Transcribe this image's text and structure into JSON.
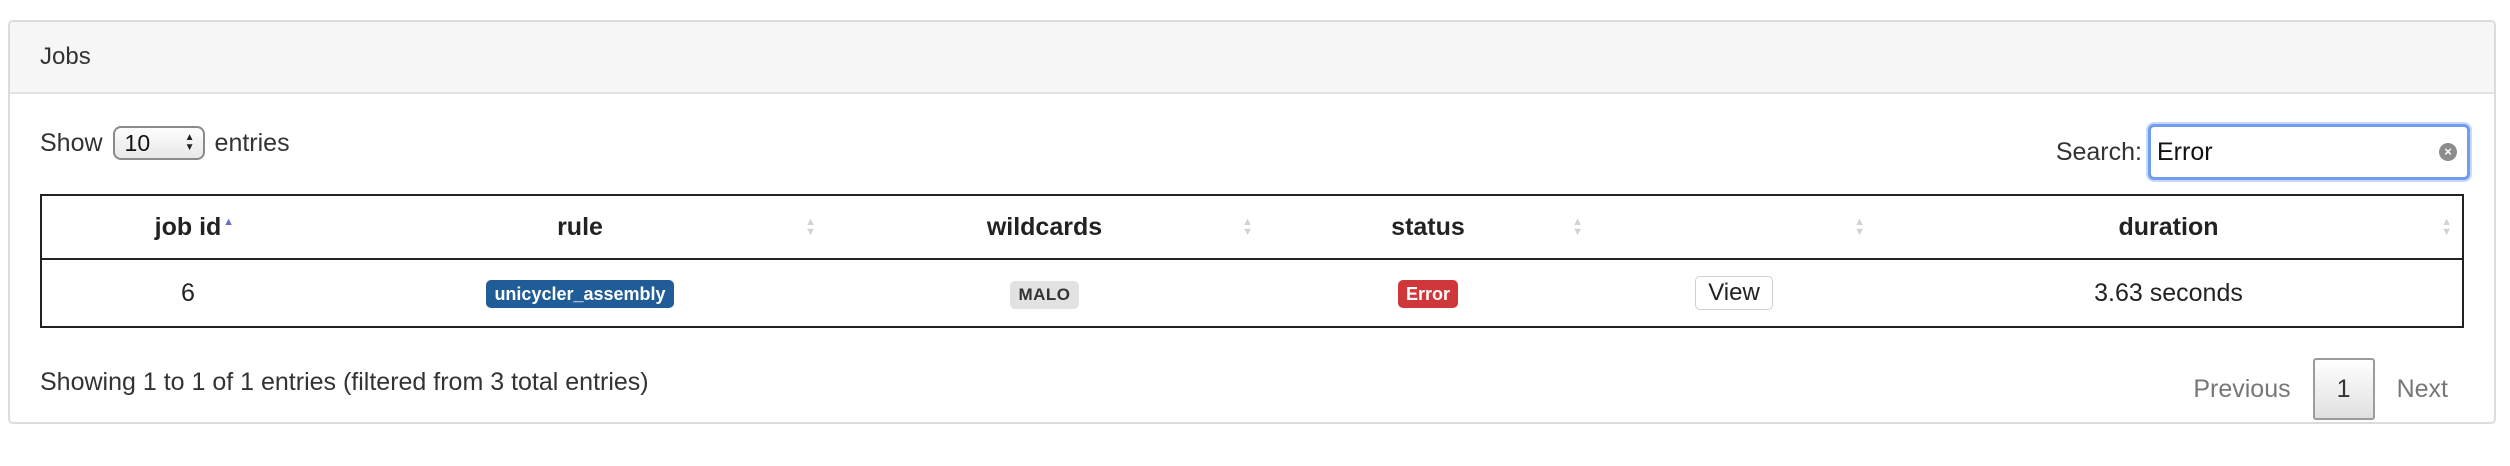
{
  "panel": {
    "title": "Jobs"
  },
  "length": {
    "prefix": "Show",
    "value": "10",
    "suffix": "entries"
  },
  "search": {
    "label": "Search:",
    "value": "Error"
  },
  "table": {
    "columns": [
      {
        "label": "job id",
        "sorted": "asc"
      },
      {
        "label": "rule",
        "sorted": "none"
      },
      {
        "label": "wildcards",
        "sorted": "none"
      },
      {
        "label": "status",
        "sorted": "none"
      },
      {
        "label": "",
        "sorted": "none"
      },
      {
        "label": "duration",
        "sorted": "none"
      }
    ],
    "rows": [
      {
        "job_id": "6",
        "rule": "unicycler_assembly",
        "wildcards": "MALO",
        "status": "Error",
        "action": "View",
        "duration": "3.63 seconds"
      }
    ]
  },
  "info": {
    "text": "Showing 1 to 1 of 1 entries (filtered from 3 total entries)"
  },
  "pagination": {
    "previous": "Previous",
    "current": "1",
    "next": "Next"
  },
  "colors": {
    "rule_badge": "#1f5c98",
    "status_error": "#d0373a",
    "wildcard_badge": "#e2e2e2",
    "search_focus": "#6f9ef0"
  }
}
